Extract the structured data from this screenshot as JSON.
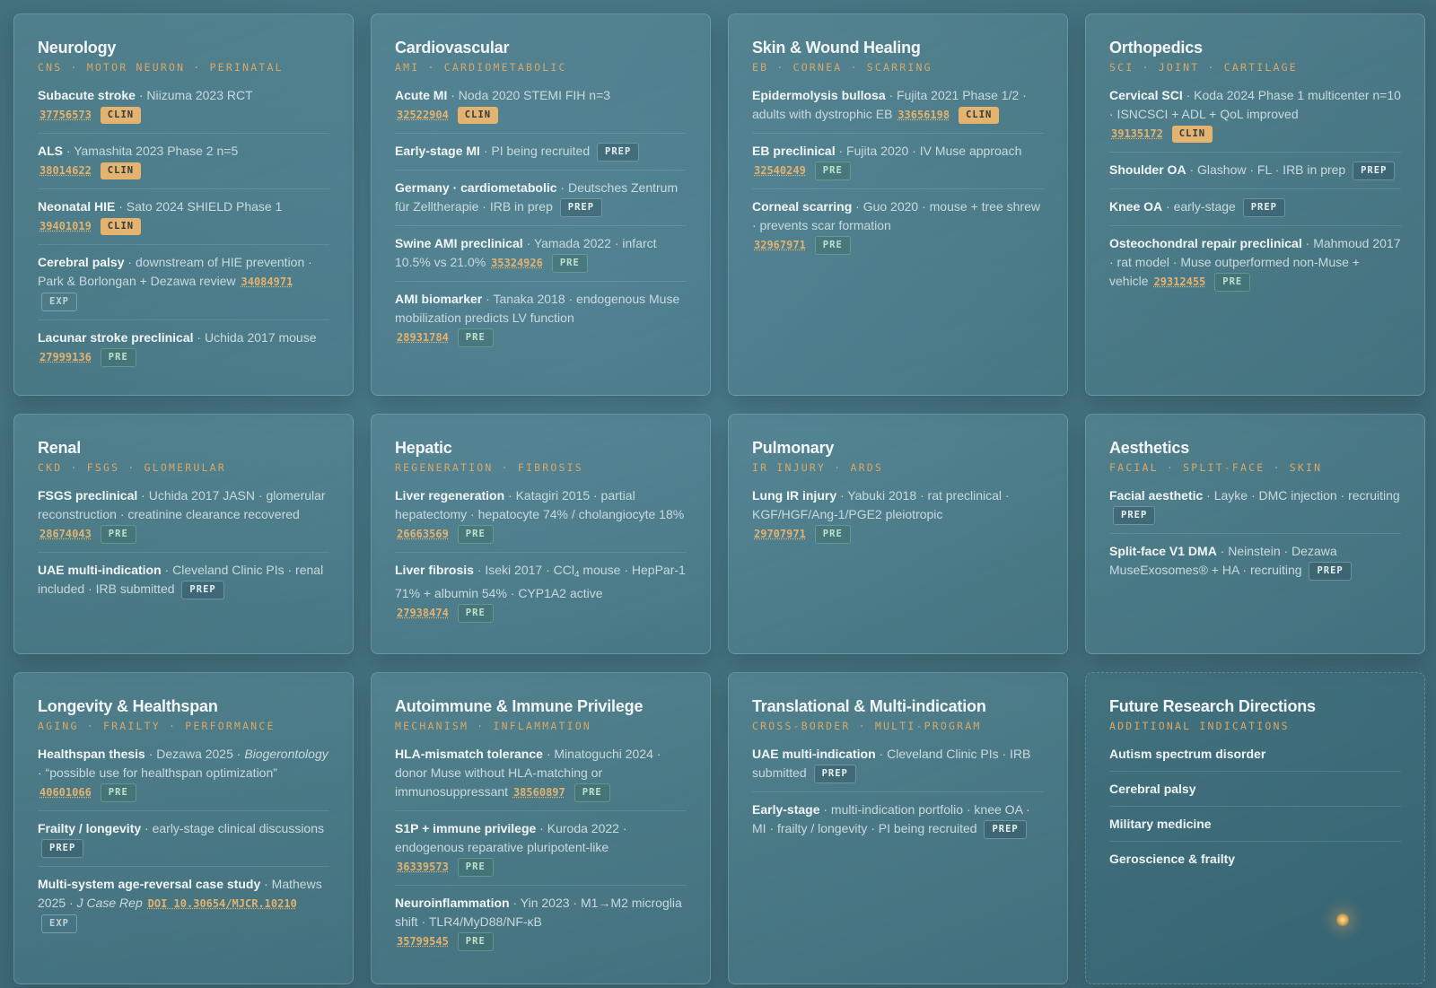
{
  "cards": {
    "neurology": {
      "title": "Neurology",
      "subtitle": "CNS · MOTOR NEURON · PERINATAL",
      "e0": {
        "name": "Subacute stroke",
        "desc": " · Niizuma 2023 RCT",
        "pmid": "37756573",
        "badge": "CLIN"
      },
      "e1": {
        "name": "ALS",
        "desc": " · Yamashita 2023 Phase 2 n=5",
        "pmid": "38014622",
        "badge": "CLIN"
      },
      "e2": {
        "name": "Neonatal HIE",
        "desc": " · Sato 2024 SHIELD Phase 1",
        "pmid": "39401019",
        "badge": "CLIN"
      },
      "e3": {
        "name": "Cerebral palsy",
        "desc": " · downstream of HIE prevention · Park & Borlongan + Dezawa review",
        "pmid": "34084971",
        "badge": "EXP"
      },
      "e4": {
        "name": "Lacunar stroke preclinical",
        "desc": " · Uchida 2017 mouse",
        "pmid": "27999136",
        "badge": "PRE"
      }
    },
    "cardio": {
      "title": "Cardiovascular",
      "subtitle": "AMI · CARDIOMETABOLIC",
      "e0": {
        "name": "Acute MI",
        "desc": " · Noda 2020 STEMI FIH n=3",
        "pmid": "32522904",
        "badge": "CLIN"
      },
      "e1": {
        "name": "Early-stage MI",
        "desc": " · PI being recruited",
        "badge": "PREP"
      },
      "e2": {
        "name": "Germany · cardiometabolic",
        "desc": " · Deutsches Zentrum für Zelltherapie · IRB in prep",
        "badge": "PREP"
      },
      "e3": {
        "name": "Swine AMI preclinical",
        "desc": " · Yamada 2022 · infarct 10.5% vs 21.0%",
        "pmid": "35324926",
        "badge": "PRE"
      },
      "e4": {
        "name": "AMI biomarker",
        "desc": " · Tanaka 2018 · endogenous Muse mobilization predicts LV function",
        "pmid": "28931784",
        "badge": "PRE"
      }
    },
    "skin": {
      "title": "Skin & Wound Healing",
      "subtitle": "EB · CORNEA · SCARRING",
      "e0": {
        "name": "Epidermolysis bullosa",
        "desc": " · Fujita 2021 Phase 1/2 · adults with dystrophic EB",
        "pmid": "33656198",
        "badge": "CLIN"
      },
      "e1": {
        "name": "EB preclinical",
        "desc": " · Fujita 2020 · IV Muse approach",
        "pmid": "32540249",
        "badge": "PRE"
      },
      "e2": {
        "name": "Corneal scarring",
        "desc": " · Guo 2020 · mouse + tree shrew · prevents scar formation",
        "pmid": "32967971",
        "badge": "PRE"
      }
    },
    "ortho": {
      "title": "Orthopedics",
      "subtitle": "SCI · JOINT · CARTILAGE",
      "e0": {
        "name": "Cervical SCI",
        "desc": " · Koda 2024 Phase 1 multicenter n=10 · ISNCSCI + ADL + QoL improved",
        "pmid": "39135172",
        "badge": "CLIN"
      },
      "e1": {
        "name": "Shoulder OA",
        "desc": " · Glashow · FL · IRB in prep",
        "badge": "PREP"
      },
      "e2": {
        "name": "Knee OA",
        "desc": " · early-stage",
        "badge": "PREP"
      },
      "e3": {
        "name": "Osteochondral repair preclinical",
        "desc": " · Mahmoud 2017 · rat model · Muse outperformed non-Muse + vehicle",
        "pmid": "29312455",
        "badge": "PRE"
      }
    },
    "renal": {
      "title": "Renal",
      "subtitle": "CKD · FSGS · GLOMERULAR",
      "e0": {
        "name": "FSGS preclinical",
        "desc": " · Uchida 2017 JASN · glomerular reconstruction · creatinine clearance recovered",
        "pmid": "28674043",
        "badge": "PRE"
      },
      "e1": {
        "name": "UAE multi-indication",
        "desc": " · Cleveland Clinic PIs · renal included · IRB submitted",
        "badge": "PREP"
      }
    },
    "hepatic": {
      "title": "Hepatic",
      "subtitle": "REGENERATION · FIBROSIS",
      "e0": {
        "name": "Liver regeneration",
        "desc": " · Katagiri 2015 · partial hepatectomy · hepatocyte 74% / cholangiocyte 18%",
        "pmid": "26663569",
        "badge": "PRE"
      },
      "e1": {
        "name": "Liver fibrosis",
        "desc_a": " · Iseki 2017 · CCl",
        "sub": "4",
        "desc_b": " mouse · HepPar-1 71% + albumin 54% · CYP1A2 active",
        "pmid": "27938474",
        "badge": "PRE"
      }
    },
    "pulmonary": {
      "title": "Pulmonary",
      "subtitle": "IR INJURY · ARDS",
      "e0": {
        "name": "Lung IR injury",
        "desc": " · Yabuki 2018 · rat preclinical · KGF/HGF/Ang-1/PGE2 pleiotropic",
        "pmid": "29707971",
        "badge": "PRE"
      }
    },
    "aesthetics": {
      "title": "Aesthetics",
      "subtitle": "FACIAL · SPLIT-FACE · SKIN",
      "e0": {
        "name": "Facial aesthetic",
        "desc": " · Layke · DMC injection · recruiting",
        "badge": "PREP"
      },
      "e1": {
        "name": "Split-face V1 DMA",
        "desc": " · Neinstein · Dezawa MuseExosomes® + HA · recruiting",
        "badge": "PREP"
      }
    },
    "longevity": {
      "title": "Longevity & Healthspan",
      "subtitle": "AGING · FRAILTY · PERFORMANCE",
      "e0": {
        "name": "Healthspan thesis",
        "desc_a": " · Dezawa 2025 · ",
        "em": "Biogerontology",
        "desc_b": " · “possible use for healthspan optimization”",
        "pmid": "40601066",
        "badge": "PRE"
      },
      "e1": {
        "name": "Frailty / longevity",
        "desc": " · early-stage clinical discussions",
        "badge": "PREP"
      },
      "e2": {
        "name": "Multi-system age-reversal case study",
        "desc_a": " · Mathews 2025 · ",
        "em": "J Case Rep",
        "pmid": "DOI 10.30654/MJCR.10210",
        "badge": "EXP"
      }
    },
    "autoimmune": {
      "title": "Autoimmune & Immune Privilege",
      "subtitle": "MECHANISM · INFLAMMATION",
      "e0": {
        "name": "HLA-mismatch tolerance",
        "desc": " · Minatoguchi 2024 · donor Muse without HLA-matching or immunosuppressant",
        "pmid": "38560897",
        "badge": "PRE"
      },
      "e1": {
        "name": "S1P + immune privilege",
        "desc": " · Kuroda 2022 · endogenous reparative pluripotent-like",
        "pmid": "36339573",
        "badge": "PRE"
      },
      "e2": {
        "name": "Neuroinflammation",
        "desc": " · Yin 2023 · M1→M2 microglia shift · TLR4/MyD88/NF-κB",
        "pmid": "35799545",
        "badge": "PRE"
      }
    },
    "translational": {
      "title": "Translational & Multi-indication",
      "subtitle": "CROSS-BORDER · MULTI-PROGRAM",
      "e0": {
        "name": "UAE multi-indication",
        "desc": " · Cleveland Clinic PIs · IRB submitted",
        "badge": "PREP"
      },
      "e1": {
        "name": "Early-stage",
        "desc": " · multi-indication portfolio · knee OA · MI · frailty / longevity · PI being recruited",
        "badge": "PREP"
      }
    },
    "future": {
      "title": "Future Research Directions",
      "subtitle": "ADDITIONAL INDICATIONS",
      "items": [
        "Autism spectrum disorder",
        "Cerebral palsy",
        "Military medicine",
        "Geroscience & frailty"
      ]
    }
  },
  "colors": {
    "accent_gold": "#e3b36f",
    "pre_green": "#bfe2cf",
    "background": "#45737f"
  }
}
